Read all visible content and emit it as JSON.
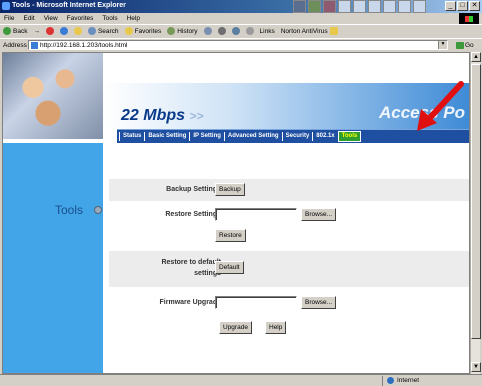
{
  "window": {
    "title": "Tools - Microsoft Internet Explorer",
    "buttons": {
      "minimize": "_",
      "maximize": "□",
      "close": "✕"
    }
  },
  "menubar": [
    "File",
    "Edit",
    "View",
    "Favorites",
    "Tools",
    "Help"
  ],
  "toolbar": {
    "back": "Back",
    "forward": "→",
    "search": "Search",
    "favorites": "Favorites",
    "history": "History",
    "links": "Links",
    "norton": "Norton AntiVirus"
  },
  "addressbar": {
    "label": "Address",
    "url": "http://192.168.1.203/tools.html",
    "go": "Go"
  },
  "header": {
    "speed": "22 Mbps",
    "speed_arrows": ">>",
    "brand": "Access Po"
  },
  "nav": {
    "items": [
      "Status",
      "Basic Setting",
      "IP Setting",
      "Advanced Setting",
      "Security",
      "802.1x",
      "Tools"
    ],
    "active_index": 6
  },
  "sidebar": {
    "title": "Tools"
  },
  "tools": {
    "backup": {
      "label": "Backup Settings",
      "button": "Backup"
    },
    "restore": {
      "label": "Restore Settings",
      "browse": "Browse...",
      "button": "Restore"
    },
    "default": {
      "label_line1": "Restore to default",
      "label_line2": "settings",
      "button": "Default"
    },
    "firmware": {
      "label": "Firmware Upgrade",
      "browse": "Browse...",
      "upgrade": "Upgrade",
      "help": "Help"
    }
  },
  "statusbar": {
    "zone": "Internet"
  },
  "colors": {
    "nav_bg": "#1e4fa0",
    "active_tab": "#2f9d2f",
    "sidebar": "#42a5e8",
    "arrow": "#e01010"
  }
}
